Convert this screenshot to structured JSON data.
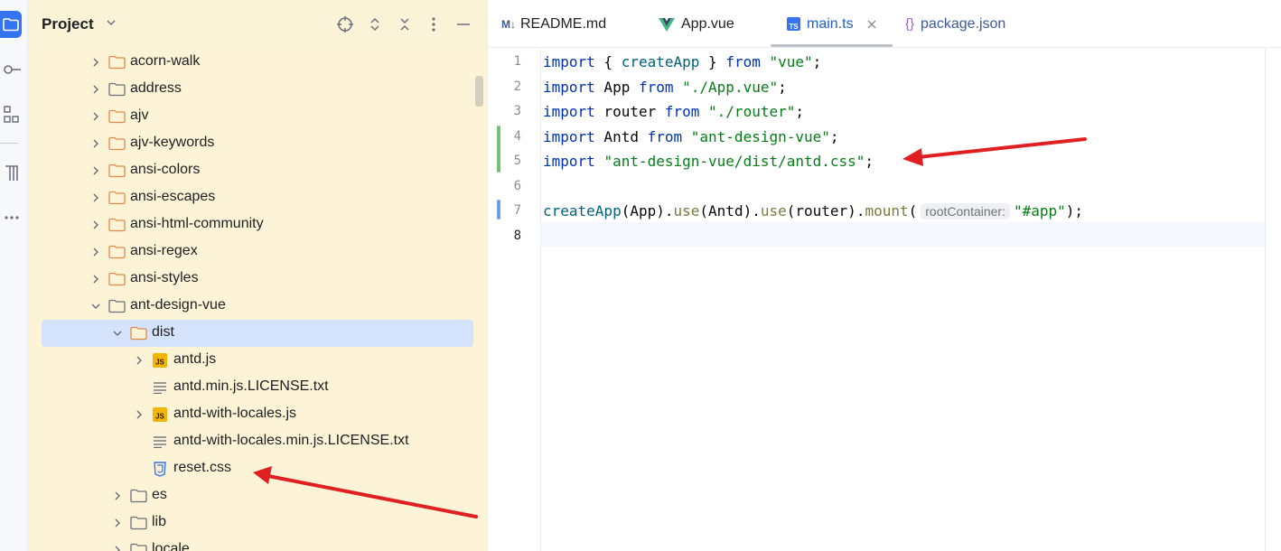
{
  "project_panel": {
    "title": "Project",
    "tree": [
      {
        "label": "acorn-walk",
        "type": "folder",
        "expanded": false,
        "depth": 0
      },
      {
        "label": "address",
        "type": "folder-plain",
        "expanded": false,
        "depth": 0
      },
      {
        "label": "ajv",
        "type": "folder",
        "expanded": false,
        "depth": 0
      },
      {
        "label": "ajv-keywords",
        "type": "folder",
        "expanded": false,
        "depth": 0
      },
      {
        "label": "ansi-colors",
        "type": "folder",
        "expanded": false,
        "depth": 0
      },
      {
        "label": "ansi-escapes",
        "type": "folder",
        "expanded": false,
        "depth": 0
      },
      {
        "label": "ansi-html-community",
        "type": "folder",
        "expanded": false,
        "depth": 0
      },
      {
        "label": "ansi-regex",
        "type": "folder",
        "expanded": false,
        "depth": 0
      },
      {
        "label": "ansi-styles",
        "type": "folder",
        "expanded": false,
        "depth": 0
      },
      {
        "label": "ant-design-vue",
        "type": "folder-plain",
        "expanded": true,
        "depth": 0
      },
      {
        "label": "dist",
        "type": "folder",
        "expanded": true,
        "depth": 1,
        "selected": true
      },
      {
        "label": "antd.js",
        "type": "js",
        "expanded": false,
        "depth": 2
      },
      {
        "label": "antd.min.js.LICENSE.txt",
        "type": "text",
        "depth": 2
      },
      {
        "label": "antd-with-locales.js",
        "type": "js",
        "expanded": false,
        "depth": 2
      },
      {
        "label": "antd-with-locales.min.js.LICENSE.txt",
        "type": "text",
        "depth": 2
      },
      {
        "label": "reset.css",
        "type": "css",
        "depth": 2
      },
      {
        "label": "es",
        "type": "folder-plain",
        "expanded": false,
        "depth": 1
      },
      {
        "label": "lib",
        "type": "folder-plain",
        "expanded": false,
        "depth": 1
      },
      {
        "label": "locale",
        "type": "folder-plain",
        "expanded": false,
        "depth": 1
      }
    ]
  },
  "tabs": [
    {
      "label": "README.md",
      "icon": "markdown-icon",
      "badge": "M↓"
    },
    {
      "label": "App.vue",
      "icon": "vue-icon"
    },
    {
      "label": "main.ts",
      "icon": "typescript-icon",
      "badge": "TS",
      "active": true
    },
    {
      "label": "package.json",
      "icon": "json-icon",
      "badge": "{}"
    }
  ],
  "editor": {
    "line_numbers": [
      "1",
      "2",
      "3",
      "4",
      "5",
      "6",
      "7",
      "8"
    ],
    "current_line": "8",
    "lines": [
      [
        {
          "t": "import",
          "c": "kw"
        },
        {
          "t": " { ",
          "c": "plain"
        },
        {
          "t": "createApp",
          "c": "fn"
        },
        {
          "t": " } ",
          "c": "plain"
        },
        {
          "t": "from",
          "c": "kw"
        },
        {
          "t": " ",
          "c": "plain"
        },
        {
          "t": "\"vue\"",
          "c": "str"
        },
        {
          "t": ";",
          "c": "plain"
        }
      ],
      [
        {
          "t": "import",
          "c": "kw"
        },
        {
          "t": " App ",
          "c": "plain"
        },
        {
          "t": "from",
          "c": "kw"
        },
        {
          "t": " ",
          "c": "plain"
        },
        {
          "t": "\"./App.vue\"",
          "c": "str"
        },
        {
          "t": ";",
          "c": "plain"
        }
      ],
      [
        {
          "t": "import",
          "c": "kw"
        },
        {
          "t": " router ",
          "c": "plain"
        },
        {
          "t": "from",
          "c": "kw"
        },
        {
          "t": " ",
          "c": "plain"
        },
        {
          "t": "\"./router\"",
          "c": "str"
        },
        {
          "t": ";",
          "c": "plain"
        }
      ],
      [
        {
          "t": "import",
          "c": "kw"
        },
        {
          "t": " Antd ",
          "c": "plain"
        },
        {
          "t": "from",
          "c": "kw"
        },
        {
          "t": " ",
          "c": "plain"
        },
        {
          "t": "\"ant-design-vue\"",
          "c": "str"
        },
        {
          "t": ";",
          "c": "plain"
        }
      ],
      [
        {
          "t": "import",
          "c": "kw"
        },
        {
          "t": " ",
          "c": "plain"
        },
        {
          "t": "\"ant-design-vue/dist/antd.css\"",
          "c": "str"
        },
        {
          "t": ";",
          "c": "plain"
        }
      ],
      [],
      [
        {
          "t": "createApp",
          "c": "fn"
        },
        {
          "t": "(App).",
          "c": "plain"
        },
        {
          "t": "use",
          "c": "mth"
        },
        {
          "t": "(Antd).",
          "c": "plain"
        },
        {
          "t": "use",
          "c": "mth"
        },
        {
          "t": "(router).",
          "c": "plain"
        },
        {
          "t": "mount",
          "c": "mth"
        },
        {
          "t": "(",
          "c": "plain"
        },
        {
          "t": "rootContainer:",
          "c": "hint"
        },
        {
          "t": "\"#app\"",
          "c": "str"
        },
        {
          "t": ");",
          "c": "plain"
        }
      ],
      []
    ]
  },
  "colors": {
    "accent": "#3574f0",
    "project_bg": "#fdf4d8",
    "selection": "#d4e2fb",
    "annotation_arrow": "#e02020",
    "vcs_added": "#74c077",
    "vcs_modified": "#6f9ee8"
  }
}
